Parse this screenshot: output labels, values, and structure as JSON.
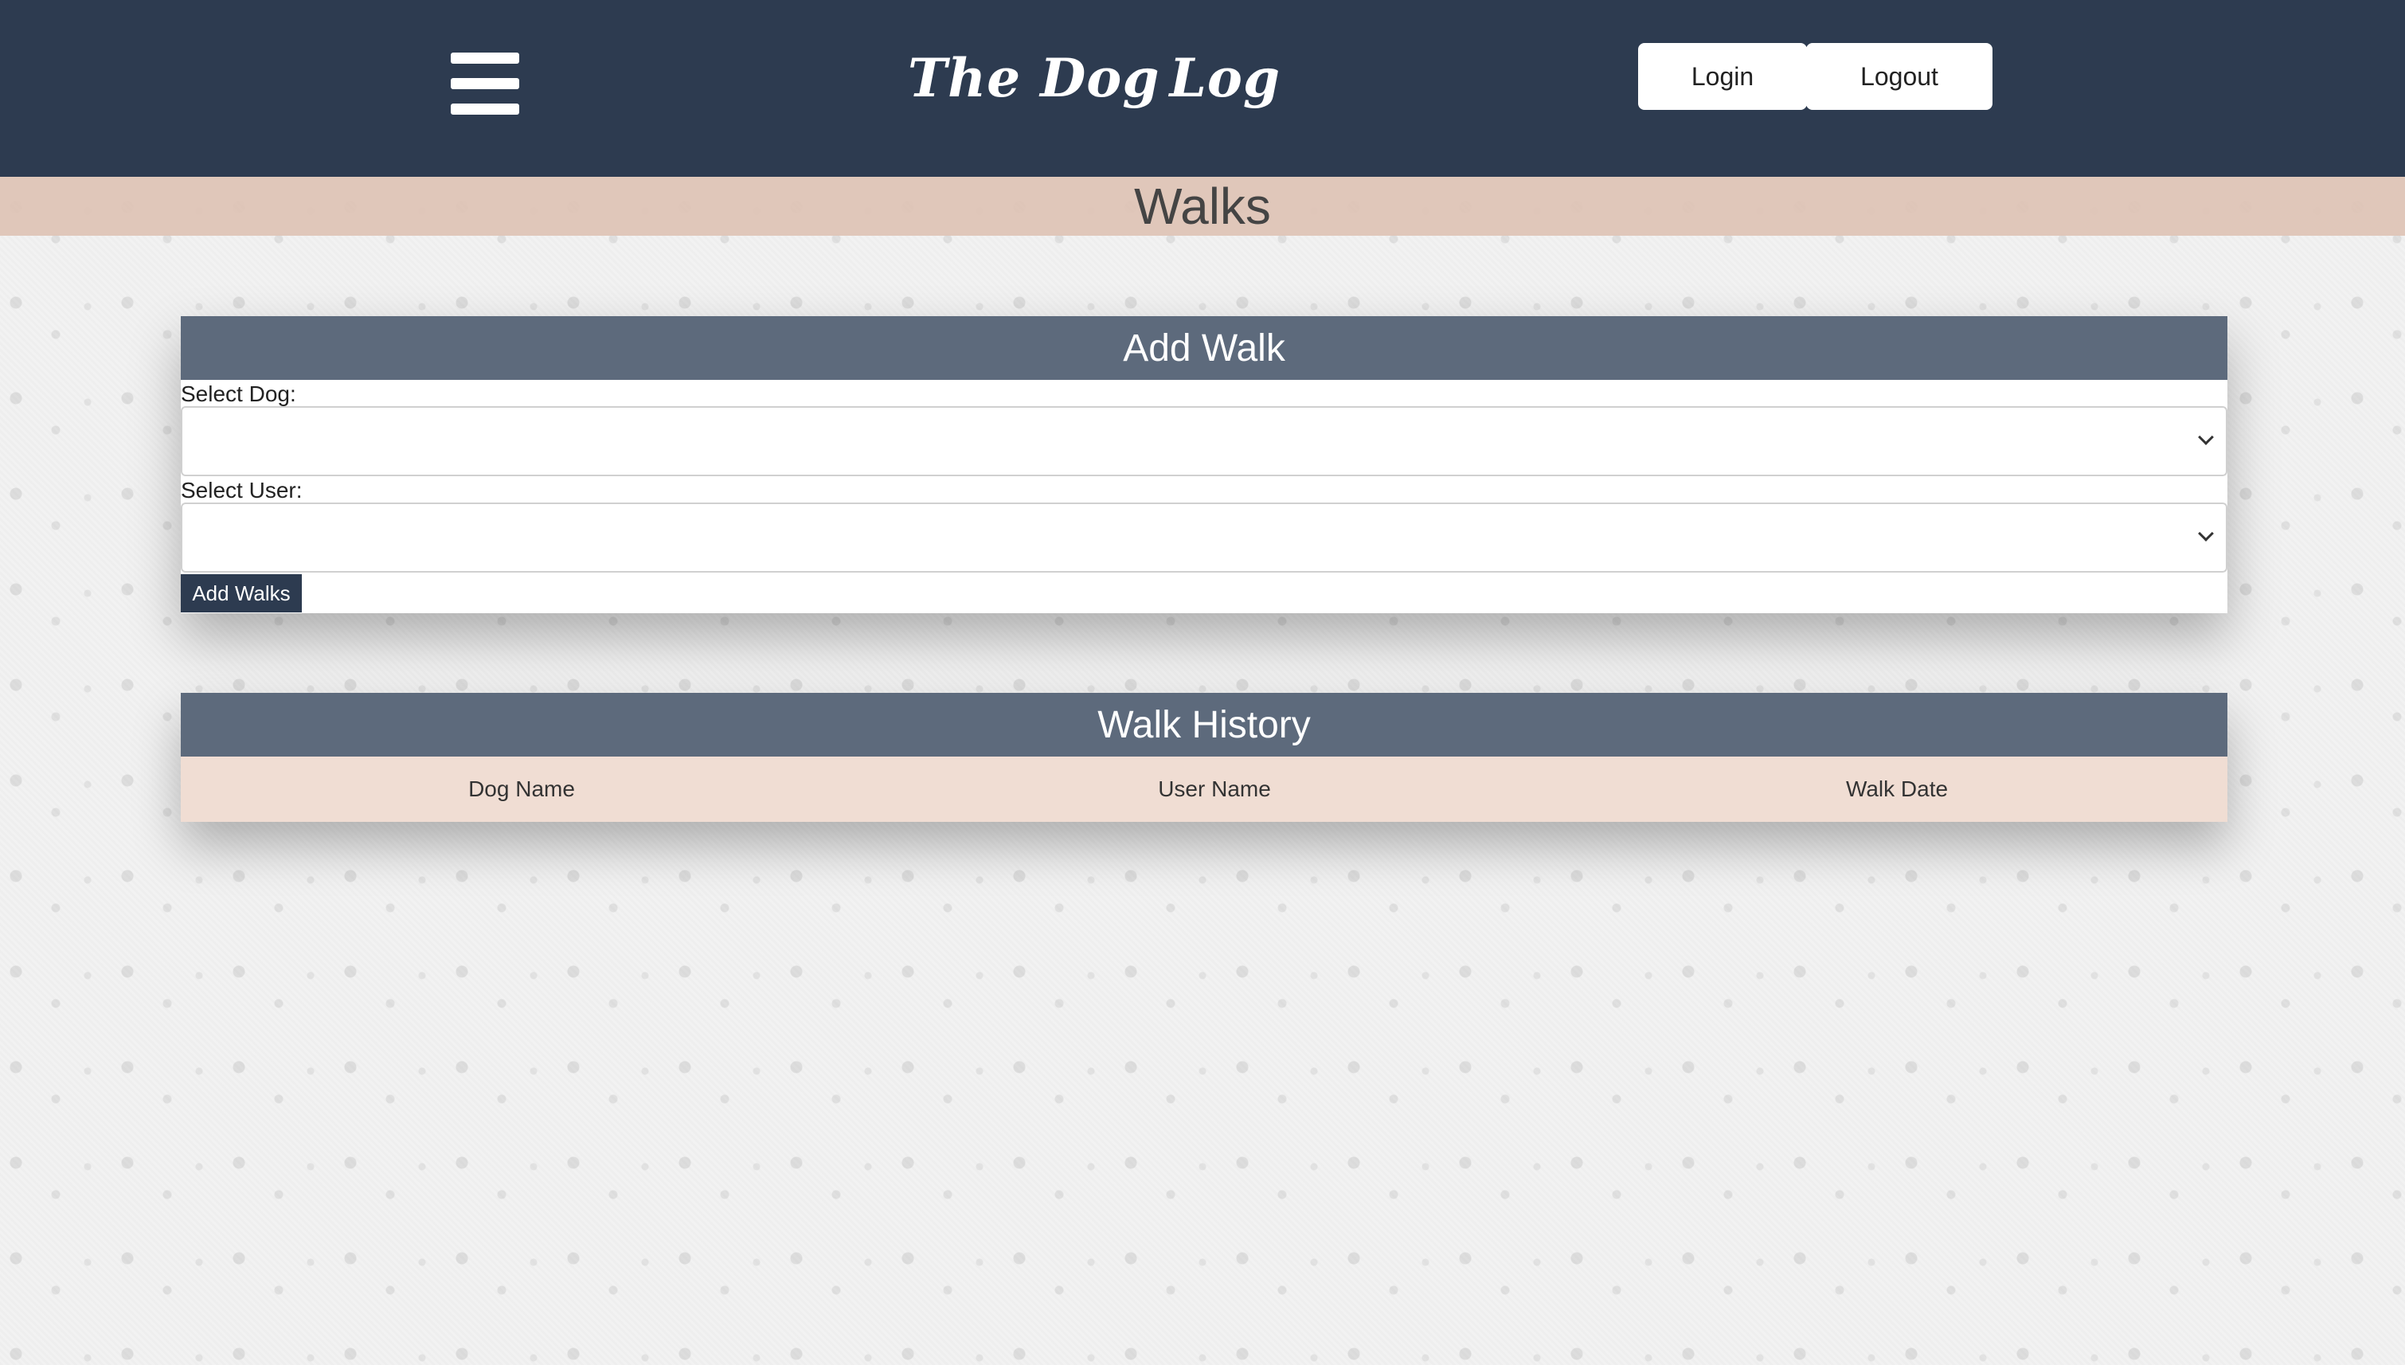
{
  "header": {
    "logo_text_left": "The Dog",
    "logo_text_right": "Log",
    "login_label": "Login",
    "logout_label": "Logout",
    "menu_icon": "hamburger-menu-icon",
    "logo_icon": "dog-icon"
  },
  "page": {
    "title": "Walks"
  },
  "add_walk": {
    "heading": "Add Walk",
    "dog_label": "Select Dog:",
    "dog_value": "",
    "user_label": "Select User:",
    "user_value": "",
    "submit_label": "Add Walks"
  },
  "walk_history": {
    "heading": "Walk History",
    "columns": [
      "Dog Name",
      "User Name",
      "Walk Date"
    ],
    "rows": []
  },
  "colors": {
    "header_bg": "#2d3b50",
    "card_head_bg": "#5d6a7c",
    "title_band_bg": "#dec4b6",
    "table_header_bg": "#f0ddd3"
  }
}
